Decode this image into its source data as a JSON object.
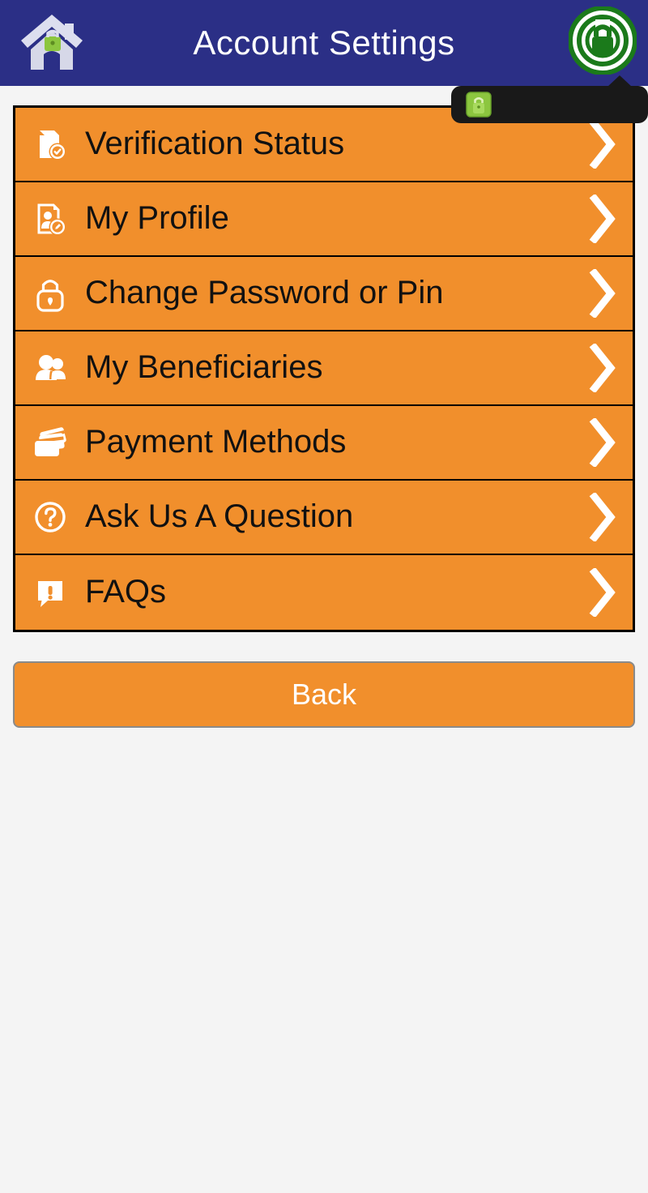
{
  "header": {
    "title": "Account Settings",
    "home_icon": "home-lock-icon",
    "lock_icon": "secure-lock-icon",
    "background_color": "#2b2f86",
    "title_color": "#ffffff"
  },
  "tooltip": {
    "icon": "green-padlock-icon",
    "text": "",
    "background_color": "#191919"
  },
  "menu": {
    "accent_color": "#f18f2c",
    "border_color": "#000000",
    "items": [
      {
        "label": "Verification Status",
        "icon": "document-check-icon",
        "chevron": "chevron-right-icon"
      },
      {
        "label": "My Profile",
        "icon": "profile-edit-icon",
        "chevron": "chevron-right-icon"
      },
      {
        "label": "Change Password or Pin",
        "icon": "padlock-icon",
        "chevron": "chevron-right-icon"
      },
      {
        "label": "My Beneficiaries",
        "icon": "people-icon",
        "chevron": "chevron-right-icon"
      },
      {
        "label": "Payment Methods",
        "icon": "credit-cards-icon",
        "chevron": "chevron-right-icon"
      },
      {
        "label": "Ask Us A Question",
        "icon": "question-circle-icon",
        "chevron": "chevron-right-icon"
      },
      {
        "label": "FAQs",
        "icon": "speech-alert-icon",
        "chevron": "chevron-right-icon"
      }
    ]
  },
  "footer": {
    "back_label": "Back",
    "back_color": "#f18f2c",
    "back_text_color": "#ffffff"
  }
}
